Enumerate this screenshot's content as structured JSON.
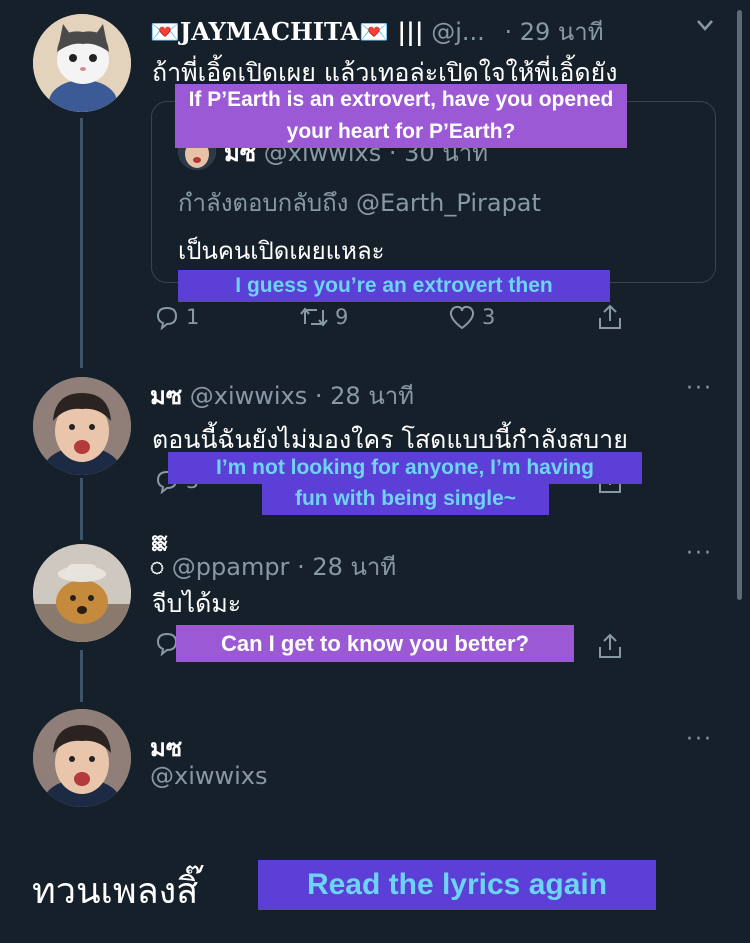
{
  "tweet1": {
    "display_name": "💌JAYMACHITA💌 |||",
    "handle": "@j...",
    "time": "· 29 นาที",
    "text": "ถ้าพี่เอิ้ดเปิดเผย แล้วเทอล่ะเปิดใจให้พี่เอิ้ดยัง",
    "translation": "If P’Earth is an extrovert,  have you opened your heart for P’Earth?",
    "quote": {
      "display_name": "มซ",
      "handle": "@xiwwixs",
      "time": "· 30 นาที",
      "reply_to": "กำลังตอบกลับถึง @Earth_Pirapat",
      "text": "เป็นคนเปิดเผยแหละ",
      "translation": "I guess you’re an extrovert then"
    },
    "replies": "1",
    "retweets": "9",
    "likes": "3"
  },
  "tweet2": {
    "display_name": "มซ",
    "handle": "@xiwwixs",
    "time": "· 28 นาที",
    "text": "ตอนนี้ฉันยังไม่มองใคร โสดแบบนี้กำลังสบาย",
    "translation_line1": "I’m not looking for anyone, I’m having",
    "translation_line2": "fun with being single~",
    "partial_count": "5"
  },
  "tweet3": {
    "display_name": "ᢆ",
    "handle": "@ppampr",
    "time": "· 28 นาที",
    "text": "จีบได้มะ",
    "translation": "Can I get to know you better?"
  },
  "tweet4": {
    "display_name": "มซ",
    "handle": "@xiwwixs"
  },
  "footer": {
    "thai": "ทวนเพลงสิ๊",
    "translation": "Read the lyrics again"
  },
  "colors": {
    "background": "#15202b",
    "muted": "#8899a6",
    "overlay_purple": "#9b59d6",
    "overlay_blue": "#5b3fd6",
    "overlay_blue_text": "#6ed4f5"
  },
  "icons": [
    "reply-icon",
    "retweet-icon",
    "like-icon",
    "share-icon",
    "more-icon"
  ]
}
